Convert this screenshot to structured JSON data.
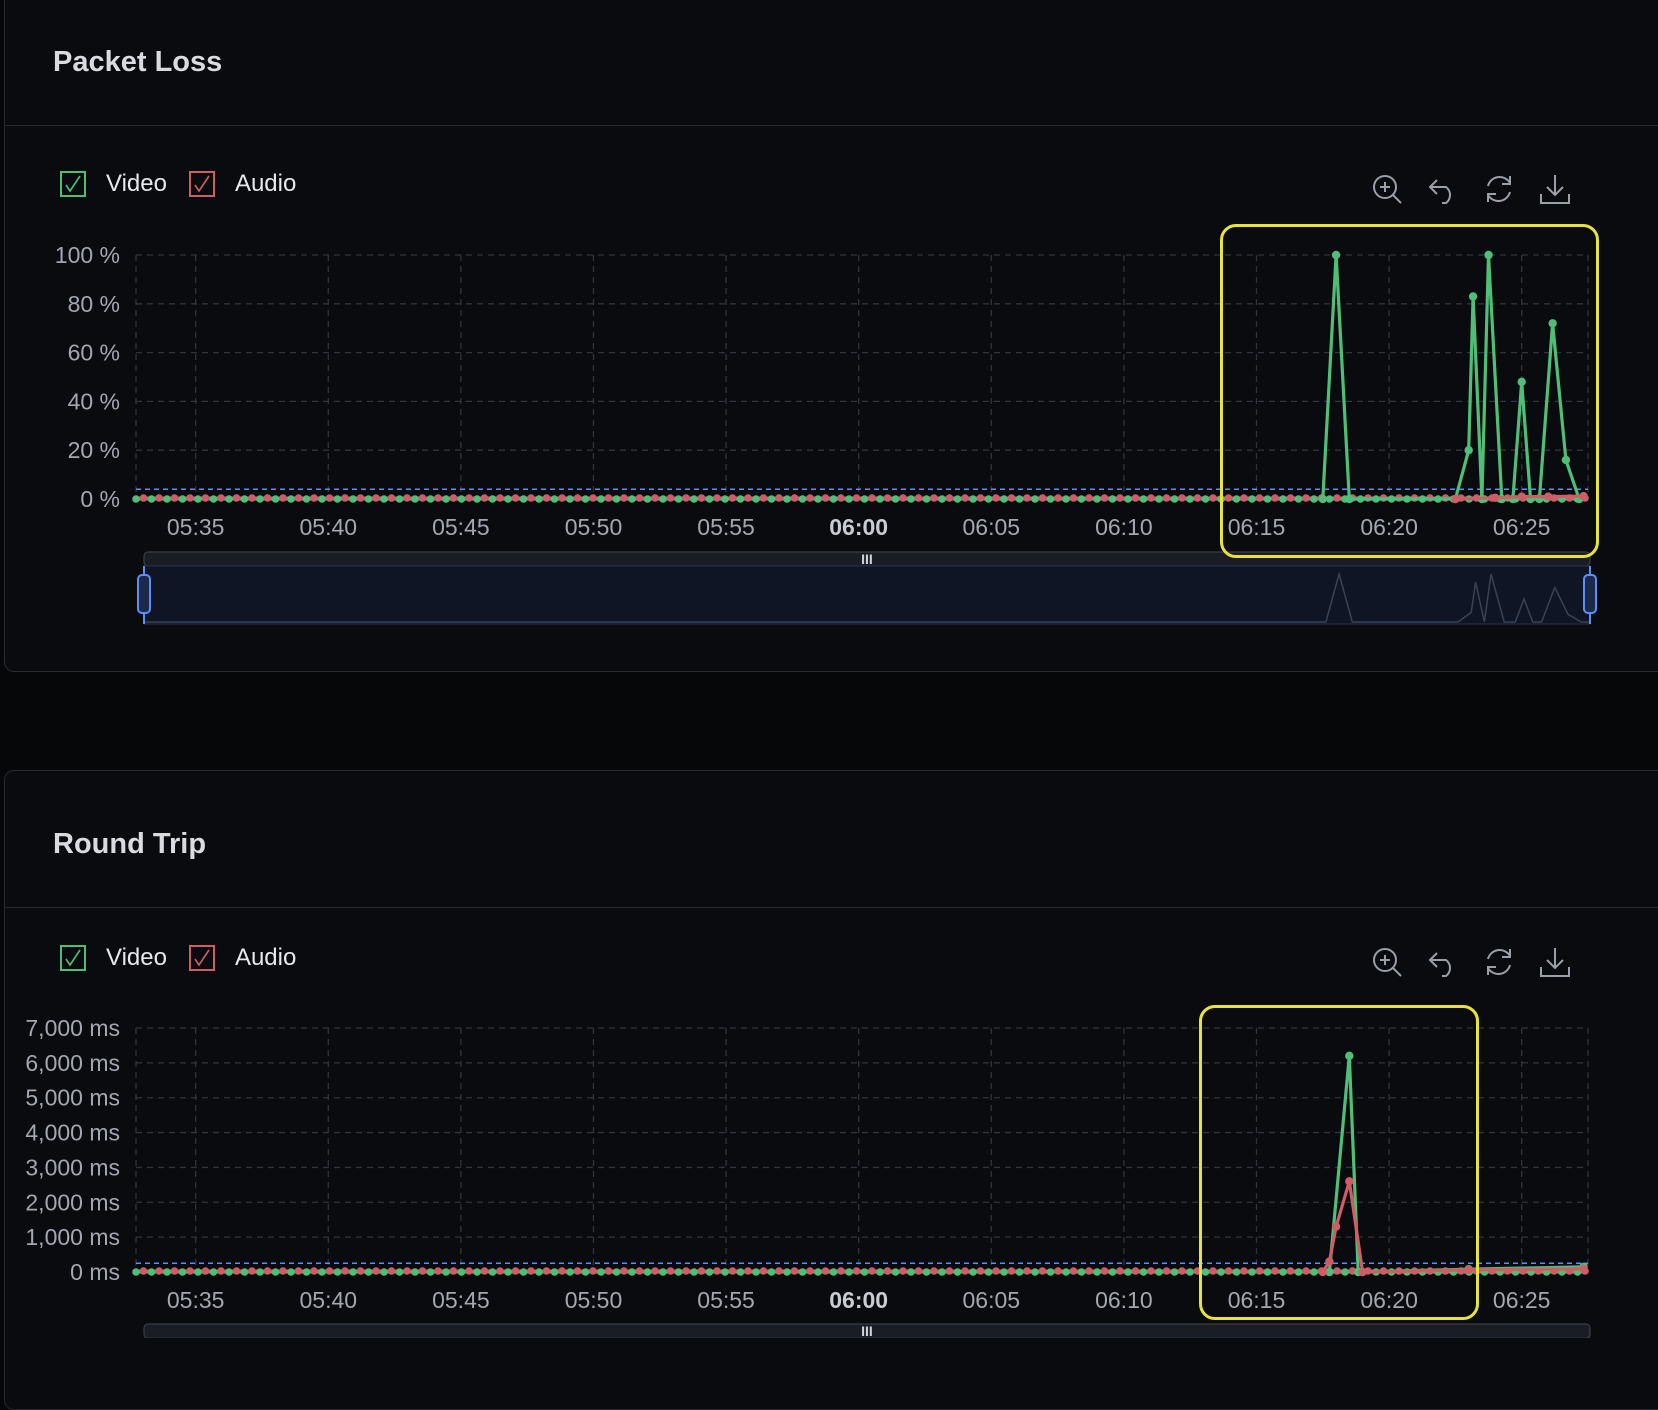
{
  "colors": {
    "video": "#4fbf78",
    "audio": "#cf5d66",
    "grid": "#31343d",
    "axis_text": "#a3a7b0",
    "highlight": "#e8e33a",
    "markline": "#5b8ff9"
  },
  "toolbox_icons": [
    "zoom-icon",
    "undo-icon",
    "refresh-icon",
    "download-icon"
  ],
  "chart_data": [
    {
      "type": "line",
      "title": "Packet Loss",
      "legend": [
        "Video",
        "Audio"
      ],
      "x_ticks": [
        "05:35",
        "05:40",
        "05:45",
        "05:50",
        "05:55",
        "06:00",
        "06:05",
        "06:10",
        "06:15",
        "06:20",
        "06:25"
      ],
      "bold_tick": "06:00",
      "y_ticks": [
        "0 %",
        "20 %",
        "40 %",
        "60 %",
        "80 %",
        "100 %"
      ],
      "ylim": [
        0,
        100
      ],
      "xlim": [
        "05:32:45",
        "06:27:30"
      ],
      "threshold": 4,
      "series": [
        {
          "name": "Video",
          "points": [
            [
              "06:17:30",
              0
            ],
            [
              "06:18:00",
              100
            ],
            [
              "06:18:30",
              0
            ],
            [
              "06:22:30",
              0
            ],
            [
              "06:23:00",
              20
            ],
            [
              "06:23:10",
              83
            ],
            [
              "06:23:30",
              0
            ],
            [
              "06:23:45",
              100
            ],
            [
              "06:24:15",
              0
            ],
            [
              "06:24:40",
              0
            ],
            [
              "06:25:00",
              48
            ],
            [
              "06:25:20",
              0
            ],
            [
              "06:25:40",
              0
            ],
            [
              "06:26:10",
              72
            ],
            [
              "06:26:40",
              16
            ],
            [
              "06:27:10",
              0
            ]
          ]
        },
        {
          "name": "Audio",
          "points": [
            [
              "06:22:30",
              0
            ],
            [
              "06:24:00",
              0.5
            ],
            [
              "06:25:00",
              1
            ],
            [
              "06:26:00",
              1
            ],
            [
              "06:27:20",
              1.2
            ]
          ]
        }
      ],
      "slider": {
        "start": 0,
        "end": 100,
        "handle_label": "III"
      }
    },
    {
      "type": "line",
      "title": "Round Trip",
      "legend": [
        "Video",
        "Audio"
      ],
      "x_ticks": [
        "05:35",
        "05:40",
        "05:45",
        "05:50",
        "05:55",
        "06:00",
        "06:05",
        "06:10",
        "06:15",
        "06:20",
        "06:25"
      ],
      "bold_tick": "06:00",
      "y_ticks": [
        "0 ms",
        "1,000 ms",
        "2,000 ms",
        "3,000 ms",
        "4,000 ms",
        "5,000 ms",
        "6,000 ms",
        "7,000 ms"
      ],
      "ylim": [
        0,
        7000
      ],
      "xlim": [
        "05:32:45",
        "06:27:30"
      ],
      "threshold": 250,
      "series": [
        {
          "name": "Video",
          "points": [
            [
              "06:17:45",
              0
            ],
            [
              "06:18:30",
              6200
            ],
            [
              "06:18:50",
              0
            ],
            [
              "06:23:00",
              80
            ],
            [
              "06:27:20",
              150
            ]
          ]
        },
        {
          "name": "Audio",
          "points": [
            [
              "06:17:30",
              0
            ],
            [
              "06:17:45",
              300
            ],
            [
              "06:18:00",
              1300
            ],
            [
              "06:18:30",
              2600
            ],
            [
              "06:19:00",
              0
            ],
            [
              "06:23:00",
              60
            ],
            [
              "06:27:20",
              90
            ]
          ]
        }
      ],
      "slider": {
        "start": 0,
        "end": 100,
        "handle_label": "III"
      }
    }
  ]
}
